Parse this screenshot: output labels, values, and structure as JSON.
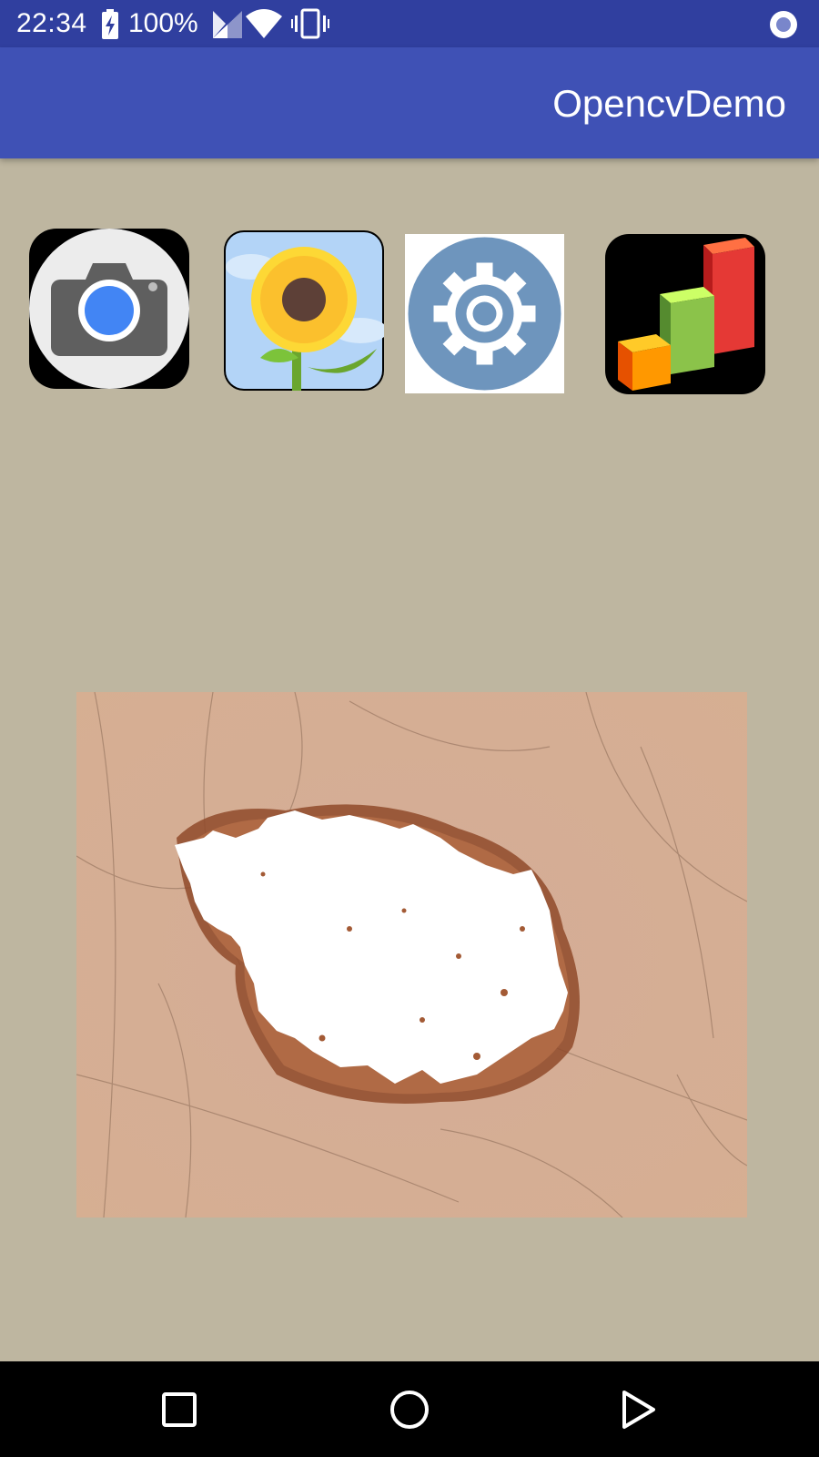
{
  "status_bar": {
    "time": "22:34",
    "battery_percent": "100%",
    "icons": [
      "battery-charging-icon",
      "signal-icon",
      "wifi-icon",
      "vibrate-icon",
      "screen-record-icon"
    ]
  },
  "app_bar": {
    "title": "OpencvDemo",
    "color": "#3f51b5"
  },
  "toolbar_icons": [
    "camera-icon",
    "gallery-sunflower-icon",
    "settings-gear-icon",
    "chart-icon"
  ],
  "image": {
    "description_icon": "segmented-skin-lesion-image"
  },
  "nav_bar": {
    "buttons": [
      "recents-icon",
      "home-icon",
      "back-icon"
    ]
  },
  "colors": {
    "background": "#beb6a0",
    "status_bar": "#303f9f",
    "app_bar": "#3f51b5"
  }
}
